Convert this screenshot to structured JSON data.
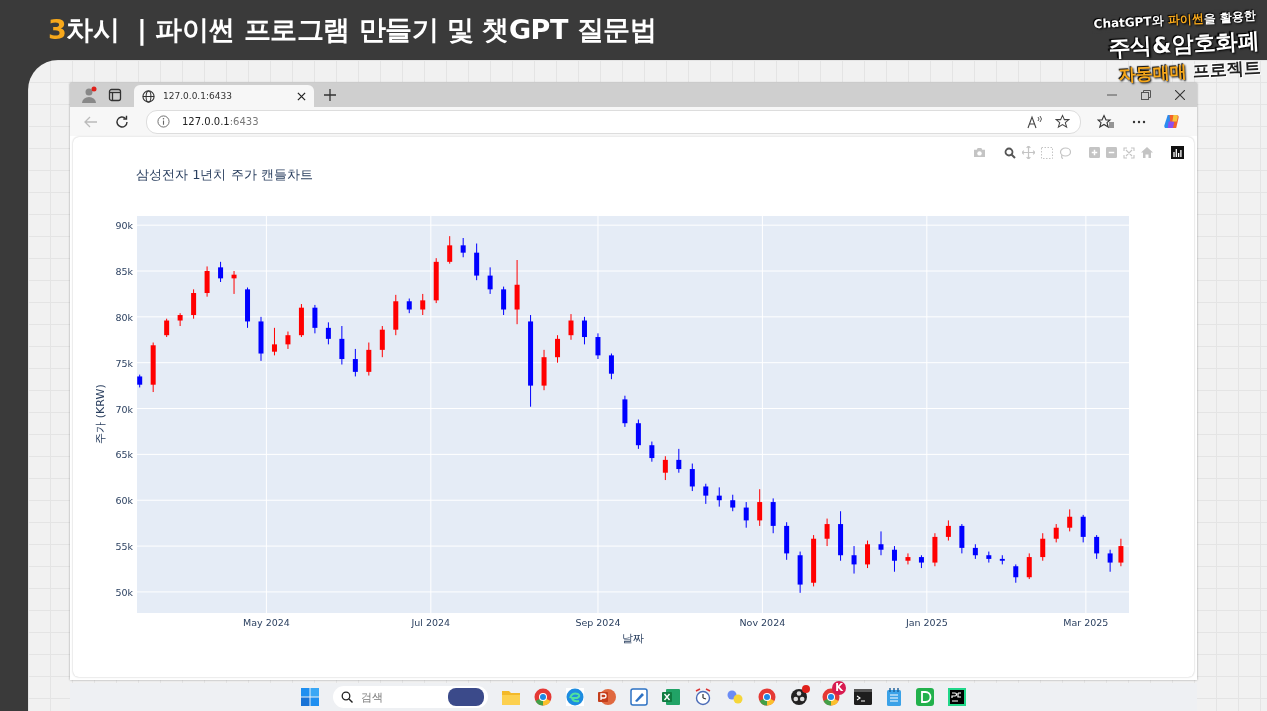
{
  "header": {
    "lesson_number": "3",
    "lesson_label": "차시",
    "title": "| 파이썬 프로그램 만들기 및 챗GPT 질문법"
  },
  "promo": {
    "tagline_start": "ChatGPT와",
    "tagline_highlight": "파이썬",
    "tagline_end": "을 활용한",
    "headline": "주식&암호화폐",
    "subline_highlight": "자동매매",
    "subline": "프로젝트"
  },
  "browser": {
    "tabs": [
      {
        "title": "127.0.0.1:6433",
        "selected": true
      }
    ],
    "back_disabled": true,
    "address": {
      "host": "127.0.0.1",
      "port": ":6433"
    }
  },
  "chart": {
    "chart_data": {
      "type": "candlestick",
      "title": "삼성전자 1년치 주가 캔들차트",
      "xlabel": "날짜",
      "ylabel": "주가 (KRW)",
      "grid": true,
      "xlim": [
        "2024-03-14",
        "2025-03-17"
      ],
      "ylim": [
        47700,
        91000
      ],
      "yticks": [
        {
          "value": 90000,
          "label": "90k"
        },
        {
          "value": 85000,
          "label": "85k"
        },
        {
          "value": 80000,
          "label": "80k"
        },
        {
          "value": 75000,
          "label": "75k"
        },
        {
          "value": 70000,
          "label": "70k"
        },
        {
          "value": 65000,
          "label": "65k"
        },
        {
          "value": 60000,
          "label": "60k"
        },
        {
          "value": 55000,
          "label": "55k"
        },
        {
          "value": 50000,
          "label": "50k"
        }
      ],
      "xticks": [
        {
          "value": "2024-05-01",
          "label": "May 2024"
        },
        {
          "value": "2024-07-01",
          "label": "Jul 2024"
        },
        {
          "value": "2024-09-01",
          "label": "Sep 2024"
        },
        {
          "value": "2024-11-01",
          "label": "Nov 2024"
        },
        {
          "value": "2025-01-01",
          "label": "Jan 2025"
        },
        {
          "value": "2025-03-01",
          "label": "Mar 2025"
        }
      ],
      "x": [
        "2024-03-15",
        "2024-03-20",
        "2024-03-25",
        "2024-03-30",
        "2024-04-04",
        "2024-04-09",
        "2024-04-14",
        "2024-04-19",
        "2024-04-24",
        "2024-04-29",
        "2024-05-04",
        "2024-05-09",
        "2024-05-14",
        "2024-05-19",
        "2024-05-24",
        "2024-05-29",
        "2024-06-03",
        "2024-06-08",
        "2024-06-13",
        "2024-06-18",
        "2024-06-23",
        "2024-06-28",
        "2024-07-03",
        "2024-07-08",
        "2024-07-13",
        "2024-07-18",
        "2024-07-23",
        "2024-07-28",
        "2024-08-02",
        "2024-08-07",
        "2024-08-12",
        "2024-08-17",
        "2024-08-22",
        "2024-08-27",
        "2024-09-01",
        "2024-09-06",
        "2024-09-11",
        "2024-09-16",
        "2024-09-21",
        "2024-09-26",
        "2024-10-01",
        "2024-10-06",
        "2024-10-11",
        "2024-10-16",
        "2024-10-21",
        "2024-10-26",
        "2024-10-31",
        "2024-11-05",
        "2024-11-10",
        "2024-11-15",
        "2024-11-20",
        "2024-11-25",
        "2024-11-30",
        "2024-12-05",
        "2024-12-10",
        "2024-12-15",
        "2024-12-20",
        "2024-12-25",
        "2024-12-30",
        "2025-01-04",
        "2025-01-09",
        "2025-01-14",
        "2025-01-19",
        "2025-01-24",
        "2025-01-29",
        "2025-02-03",
        "2025-02-08",
        "2025-02-13",
        "2025-02-18",
        "2025-02-23",
        "2025-02-28",
        "2025-03-05",
        "2025-03-10",
        "2025-03-14"
      ],
      "ohlc": [
        [
          73500,
          73700,
          72300,
          72600
        ],
        [
          72600,
          77200,
          71800,
          76900
        ],
        [
          78000,
          79800,
          77800,
          79600
        ],
        [
          79600,
          80400,
          79000,
          80200
        ],
        [
          80200,
          83000,
          79800,
          82600
        ],
        [
          82600,
          85500,
          82200,
          85000
        ],
        [
          85400,
          86000,
          83800,
          84200
        ],
        [
          84200,
          85000,
          82500,
          84600
        ],
        [
          83000,
          83200,
          78800,
          79500
        ],
        [
          79500,
          80000,
          75200,
          76000
        ],
        [
          76200,
          78800,
          75800,
          77000
        ],
        [
          77000,
          78400,
          76500,
          78000
        ],
        [
          78000,
          81400,
          77800,
          81000
        ],
        [
          81000,
          81300,
          78200,
          78800
        ],
        [
          78800,
          79400,
          77000,
          77600
        ],
        [
          77600,
          79000,
          74800,
          75400
        ],
        [
          75400,
          76500,
          73500,
          74000
        ],
        [
          74000,
          77200,
          73600,
          76400
        ],
        [
          76400,
          79000,
          75600,
          78600
        ],
        [
          78600,
          82400,
          78000,
          81700
        ],
        [
          81700,
          82000,
          80400,
          80800
        ],
        [
          80800,
          82500,
          80200,
          81800
        ],
        [
          81800,
          86400,
          81500,
          86000
        ],
        [
          86000,
          88800,
          85800,
          87800
        ],
        [
          87800,
          88600,
          86500,
          87000
        ],
        [
          87000,
          88000,
          84000,
          84500
        ],
        [
          84500,
          85400,
          82500,
          83000
        ],
        [
          83000,
          83300,
          80200,
          80800
        ],
        [
          80800,
          86200,
          79200,
          83500
        ],
        [
          79500,
          80200,
          70200,
          72500
        ],
        [
          72500,
          76400,
          72000,
          75600
        ],
        [
          75600,
          78000,
          75000,
          77600
        ],
        [
          78000,
          80300,
          77500,
          79600
        ],
        [
          79600,
          80000,
          77000,
          77800
        ],
        [
          77800,
          78200,
          75400,
          75800
        ],
        [
          75800,
          76000,
          73200,
          73800
        ],
        [
          71000,
          71400,
          68000,
          68400
        ],
        [
          68400,
          68800,
          65600,
          66000
        ],
        [
          66000,
          66400,
          64200,
          64600
        ],
        [
          63000,
          64800,
          62200,
          64400
        ],
        [
          64400,
          65600,
          63000,
          63400
        ],
        [
          63400,
          64000,
          61000,
          61500
        ],
        [
          61500,
          61800,
          59600,
          60500
        ],
        [
          60500,
          61400,
          59300,
          60000
        ],
        [
          60000,
          60600,
          58800,
          59200
        ],
        [
          59200,
          59800,
          57000,
          57800
        ],
        [
          57800,
          61200,
          57200,
          59800
        ],
        [
          59800,
          60200,
          56400,
          57200
        ],
        [
          57200,
          57600,
          53500,
          54200
        ],
        [
          54000,
          54400,
          49900,
          50800
        ],
        [
          51000,
          56200,
          50600,
          55800
        ],
        [
          55800,
          58000,
          55000,
          57400
        ],
        [
          57400,
          58800,
          53400,
          54000
        ],
        [
          54000,
          55000,
          52000,
          53000
        ],
        [
          53000,
          55600,
          52600,
          55200
        ],
        [
          55200,
          56600,
          54000,
          54600
        ],
        [
          54600,
          55000,
          52200,
          53400
        ],
        [
          53400,
          54200,
          53000,
          53800
        ],
        [
          53800,
          54000,
          52600,
          53200
        ],
        [
          53200,
          56400,
          52800,
          56000
        ],
        [
          56000,
          57800,
          55600,
          57200
        ],
        [
          57200,
          57400,
          54200,
          54800
        ],
        [
          54800,
          55200,
          53600,
          54000
        ],
        [
          54000,
          54400,
          53200,
          53600
        ],
        [
          53600,
          54000,
          53000,
          53400
        ],
        [
          52800,
          53000,
          51000,
          51600
        ],
        [
          51600,
          54200,
          51400,
          53800
        ],
        [
          53800,
          56400,
          53400,
          55800
        ],
        [
          55800,
          57400,
          55400,
          57000
        ],
        [
          57000,
          59000,
          56600,
          58200
        ],
        [
          58200,
          58400,
          55400,
          56000
        ],
        [
          56000,
          56200,
          53600,
          54200
        ],
        [
          54200,
          54600,
          52200,
          53200
        ],
        [
          53200,
          55800,
          52800,
          55000
        ]
      ]
    }
  },
  "taskbar": {
    "search_placeholder": "검색",
    "app_badge": "K"
  }
}
